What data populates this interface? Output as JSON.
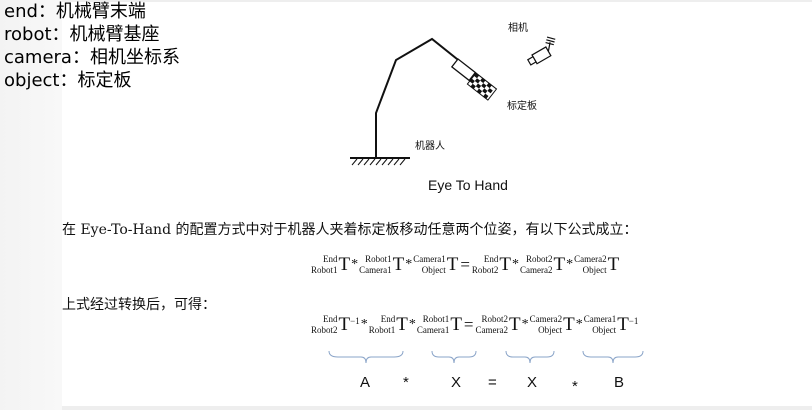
{
  "legend": [
    {
      "text": "end：机械臂末端"
    },
    {
      "text": "robot：机械臂基座"
    },
    {
      "text": "camera：相机坐标系"
    },
    {
      "text": "object：标定板"
    }
  ],
  "figure": {
    "camera_label": "相机",
    "board_label": "标定板",
    "robot_label": "机器人",
    "caption": "Eye To Hand"
  },
  "description": "在 Eye-To-Hand 的配置方式中对于机器人夹着标定板移动任意两个位姿，有以下公式成立：",
  "description2": "上式经过转换后，可得：",
  "equation1": {
    "t1": {
      "sup": "End",
      "sub": "Robot1",
      "sym": "T"
    },
    "op1": "*",
    "t2": {
      "sup": "Robot1",
      "sub": "Camera1",
      "sym": "T"
    },
    "op2": "*",
    "t3": {
      "sup": "Camera1",
      "sub": "Object",
      "sym": "T"
    },
    "eq": "=",
    "t4": {
      "sup": "End",
      "sub": "Robot2",
      "sym": "T"
    },
    "op3": "*",
    "t5": {
      "sup": "Robot2",
      "sub": "Camera2",
      "sym": "T"
    },
    "op4": "*",
    "t6": {
      "sup": "Camera2",
      "sub": "Object",
      "sym": "T"
    }
  },
  "equation2": {
    "t1": {
      "sup": "End",
      "sub": "Robot2",
      "sym": "T",
      "exp": "−1"
    },
    "op1": "*",
    "t2": {
      "sup": "End",
      "sub": "Robot1",
      "sym": "T"
    },
    "op2": "*",
    "t3": {
      "sup": "Robot1",
      "sub": "Camera1",
      "sym": "T"
    },
    "eq": "=",
    "t4": {
      "sup": "Robot2",
      "sub": "Camera2",
      "sym": "T"
    },
    "op3": "*",
    "t5": {
      "sup": "Camera2",
      "sub": "Object",
      "sym": "T"
    },
    "op4": "*",
    "t6": {
      "sup": "Camera1",
      "sub": "Object",
      "sym": "T",
      "exp": "−1"
    }
  },
  "symbols": {
    "a": "A",
    "star1": "*",
    "x1": "X",
    "eq": "=",
    "x2": "X",
    "star2": "*",
    "b": "B"
  }
}
